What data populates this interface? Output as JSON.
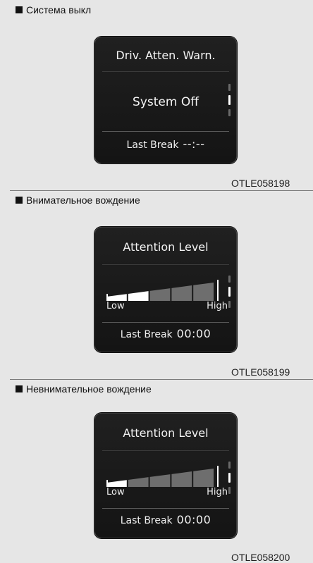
{
  "panels": [
    {
      "heading": "Система выкл",
      "screen_title": "Driv. Atten. Warn.",
      "status": "System Off",
      "last_break_label": "Last Break",
      "last_break_value": "--:--",
      "code": "OTLE058198"
    },
    {
      "heading": "Внимательное вождение",
      "screen_title": "Attention Level",
      "low_label": "Low",
      "high_label": "High",
      "attention_level": 0.4,
      "last_break_label": "Last Break",
      "last_break_value": "00:00",
      "code": "OTLE058199"
    },
    {
      "heading": "Невнимательное вождение",
      "screen_title": "Attention Level",
      "low_label": "Low",
      "high_label": "High",
      "attention_level": 0.2,
      "last_break_label": "Last Break",
      "last_break_value": "00:00",
      "code": "OTLE058200"
    }
  ]
}
